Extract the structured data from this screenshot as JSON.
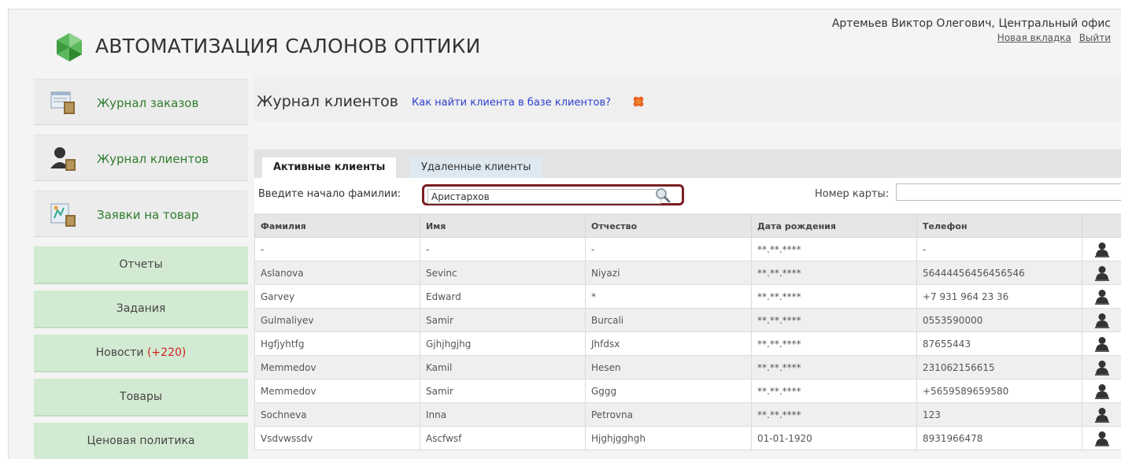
{
  "app": {
    "title": "АВТОМАТИЗАЦИЯ САЛОНОВ ОПТИКИ",
    "user": "Артемьев Виктор Олегович, Центральный офис",
    "new_tab": "Новая вкладка",
    "logout": "Выйти"
  },
  "sidebar": {
    "orders": "Журнал заказов",
    "clients": "Журнал клиентов",
    "requests": "Заявки на товар",
    "reports": "Отчеты",
    "tasks": "Задания",
    "news": "Новости",
    "news_count": "(+220)",
    "goods": "Товары",
    "pricing": "Ценовая политика"
  },
  "main": {
    "title": "Журнал клиентов",
    "help": "Как найти клиента в базе клиентов?",
    "tabs": {
      "active": "Активные клиенты",
      "deleted": "Удаленные клиенты"
    },
    "search_label": "Введите начало фамилии:",
    "search_value": "Аристархов",
    "card_label": "Номер карты:",
    "card_value": ""
  },
  "table": {
    "headers": [
      "Фамилия",
      "Имя",
      "Отчество",
      "Дата рождения",
      "Телефон"
    ],
    "rows": [
      [
        "-",
        "-",
        "-",
        "**.**.****",
        "-"
      ],
      [
        "Aslanova",
        "Sevinc",
        "Niyazi",
        "**.**.****",
        "56444456456456546"
      ],
      [
        "Garvey",
        "Edward",
        "*",
        "**.**.****",
        "+7 931 964 23 36"
      ],
      [
        "Gulmaliyev",
        "Samir",
        "Burcali",
        "**.**.****",
        "0553590000"
      ],
      [
        "Hgfjyhtfg",
        "Gjhjhgjhg",
        "Jhfdsx",
        "**.**.****",
        "87655443"
      ],
      [
        "Memmedov",
        "Kamil",
        "Hesen",
        "**.**.****",
        "231062156615"
      ],
      [
        "Memmedov",
        "Samir",
        "Gggg",
        "**.**.****",
        "+5659589659580"
      ],
      [
        "Sochneva",
        "Inna",
        "Petrovna",
        "**.**.****",
        "123"
      ],
      [
        "Vsdvwssdv",
        "Ascfwsf",
        "Hjghjgghgh",
        "01-01-1920",
        "8931966478"
      ]
    ]
  }
}
